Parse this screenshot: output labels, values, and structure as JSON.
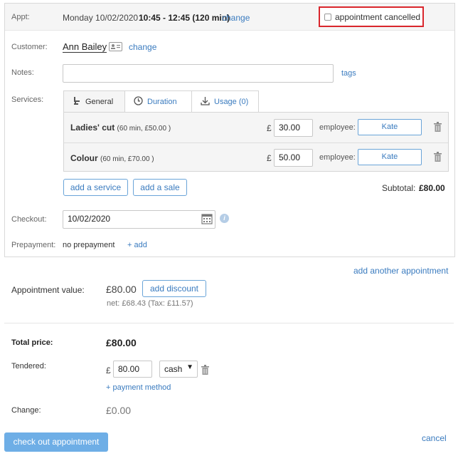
{
  "appt": {
    "label": "Appt:",
    "day": "Monday 10/02/2020",
    "time": "10:45 - 12:45 (120 min)",
    "change": "change",
    "cancelled_label": "appointment cancelled"
  },
  "customer": {
    "label": "Customer:",
    "name": "Ann Bailey",
    "change": "change"
  },
  "notes": {
    "label": "Notes:",
    "value": "",
    "tags": "tags"
  },
  "services": {
    "label": "Services:",
    "tabs": [
      {
        "label": "General",
        "icon": "dentist-chair-icon"
      },
      {
        "label": "Duration",
        "icon": "clock-icon"
      },
      {
        "label": "Usage (0)",
        "icon": "download-icon"
      }
    ],
    "rows": [
      {
        "name": "Ladies' cut",
        "meta": "(60 min, £50.00 )",
        "currency": "£",
        "price": "30.00",
        "employee_label": "employee:",
        "employee": "Kate"
      },
      {
        "name": "Colour",
        "meta": "(60 min, £70.00 )",
        "currency": "£",
        "price": "50.00",
        "employee_label": "employee:",
        "employee": "Kate"
      }
    ],
    "add_service": "add a service",
    "add_sale": "add a sale",
    "subtotal_label": "Subtotal:",
    "subtotal": "£80.00"
  },
  "checkout": {
    "label": "Checkout:",
    "date": "10/02/2020"
  },
  "prepayment": {
    "label": "Prepayment:",
    "value": "no prepayment",
    "add": "+ add"
  },
  "add_another": "add another appointment",
  "value": {
    "label": "Appointment value:",
    "amount": "£80.00",
    "add_discount": "add discount",
    "net": "net: £68.43 (Tax: £11.57)"
  },
  "total": {
    "label": "Total price:",
    "amount": "£80.00"
  },
  "tendered": {
    "label": "Tendered:",
    "currency": "£",
    "amount": "80.00",
    "method": "cash",
    "add_method": "+ payment method"
  },
  "change": {
    "label": "Change:",
    "amount": "£0.00"
  },
  "actions": {
    "checkout": "check out appointment",
    "cancel": "cancel"
  },
  "colors": {
    "accent": "#3a7bbf",
    "primary_button": "#6eaee6",
    "cancel_border": "#d9262c"
  }
}
